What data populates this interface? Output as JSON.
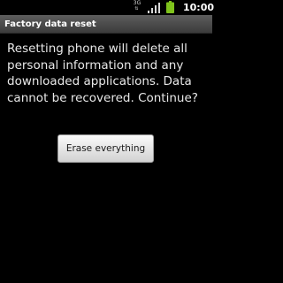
{
  "status_bar": {
    "network_type": "3G",
    "network_arrows": "⇅",
    "clock": "10:00",
    "icons": [
      "network-type-icon",
      "signal-icon",
      "battery-icon"
    ],
    "battery_color": "#7fc31c"
  },
  "dialog": {
    "title": "Factory data reset",
    "message_lines": [
      "Resetting phone will delete all",
      "personal information and any",
      "downloaded applications. Data",
      "cannot be recovered. Continue?"
    ],
    "confirm_button_label": "Erase everything"
  }
}
